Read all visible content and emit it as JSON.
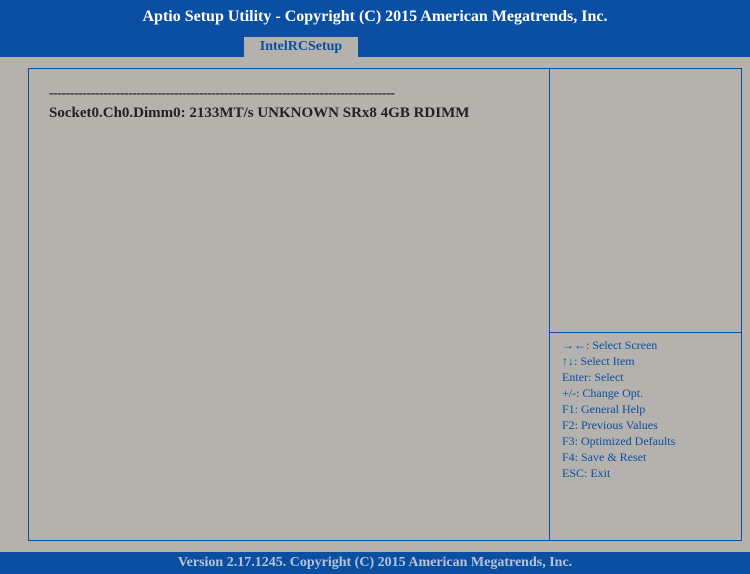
{
  "header": {
    "title": "Aptio Setup Utility - Copyright (C) 2015 American Megatrends, Inc."
  },
  "tabs": [
    {
      "label": "IntelRCSetup"
    }
  ],
  "main": {
    "separator": "-----------------------------------------------------------------------------------",
    "dimm_info": "Socket0.Ch0.Dimm0: 2133MT/s UNKNOWN SRx8 4GB RDIMM"
  },
  "help": {
    "items": [
      "→←: Select Screen",
      "↑↓: Select Item",
      "Enter: Select",
      "+/-: Change Opt.",
      "F1: General Help",
      "F2: Previous Values",
      "F3: Optimized Defaults",
      "F4: Save & Reset",
      "ESC: Exit"
    ]
  },
  "footer": {
    "version": "Version 2.17.1245. Copyright (C) 2015 American Megatrends, Inc."
  },
  "colors": {
    "accent": "#0b4fa3",
    "background": "#b5b1ad"
  }
}
